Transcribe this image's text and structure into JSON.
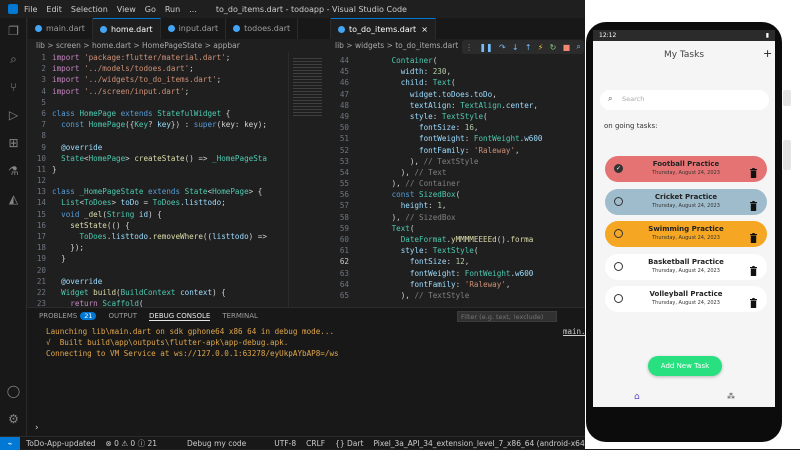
{
  "titlebar": {
    "menu": [
      "File",
      "Edit",
      "Selection",
      "View",
      "Go",
      "Run",
      "..."
    ],
    "title": "to_do_items.dart - todoapp - Visual Studio Code"
  },
  "left_editor": {
    "tabs": [
      "main.dart",
      "home.dart",
      "input.dart",
      "todoes.dart"
    ],
    "breadcrumb": "lib > screen > home.dart > HomePageState > appbar",
    "lines": [
      {
        "n": "1",
        "html": "<span class='p'>import</span> <span class='s'>'package:flutter/material.dart'</span>;"
      },
      {
        "n": "2",
        "html": "<span class='p'>import</span> <span class='s'>'../models/todoes.dart'</span>;"
      },
      {
        "n": "3",
        "html": "<span class='p'>import</span> <span class='s'>'../widgets/to_do_items.dart'</span>;"
      },
      {
        "n": "4",
        "html": "<span class='p'>import</span> <span class='s'>'../screen/input.dart'</span>;"
      },
      {
        "n": "5",
        "html": ""
      },
      {
        "n": "6",
        "html": "<span class='k'>class</span> <span class='t'>HomePage</span> <span class='k'>extends</span> <span class='t'>StatefulWidget</span> {"
      },
      {
        "n": "7",
        "html": "  <span class='k'>const</span> <span class='t'>HomePage</span>({<span class='t'>Key</span>? <span class='v'>key</span>}) : <span class='k'>super</span>(key: key);"
      },
      {
        "n": "8",
        "html": ""
      },
      {
        "n": "9",
        "html": "  <span class='v'>@override</span>"
      },
      {
        "n": "10",
        "html": "  <span class='t'>State</span>&lt;<span class='t'>HomePage</span>&gt; <span class='f'>createState</span>() =&gt; <span class='t'>_HomePageSta</span>"
      },
      {
        "n": "11",
        "html": "}"
      },
      {
        "n": "12",
        "html": ""
      },
      {
        "n": "13",
        "html": "<span class='k'>class</span> <span class='t'>_HomePageState</span> <span class='k'>extends</span> <span class='t'>State</span>&lt;<span class='t'>HomePage</span>&gt; {"
      },
      {
        "n": "14",
        "html": "  <span class='t'>List</span>&lt;<span class='t'>ToDoes</span>&gt; <span class='v'>toDo</span> = <span class='t'>ToDoes</span>.<span class='v'>listtodo</span>;"
      },
      {
        "n": "15",
        "html": "  <span class='k'>void</span> <span class='f'>_del</span>(<span class='t'>String</span> <span class='v'>id</span>) {"
      },
      {
        "n": "16",
        "html": "    <span class='f'>setState</span>(() {"
      },
      {
        "n": "17",
        "html": "      <span class='t'>ToDoes</span>.<span class='v'>listtodo</span>.<span class='f'>removeWhere</span>((<span class='v'>listtodo</span>) =&gt;"
      },
      {
        "n": "18",
        "html": "    });"
      },
      {
        "n": "19",
        "html": "  }"
      },
      {
        "n": "20",
        "html": ""
      },
      {
        "n": "21",
        "html": "  <span class='v'>@override</span>"
      },
      {
        "n": "22",
        "html": "  <span class='t'>Widget</span> <span class='f'>build</span>(<span class='t'>BuildContext</span> <span class='v'>context</span>) {"
      },
      {
        "n": "23",
        "html": "    <span class='p'>return</span> <span class='t'>Scaffold</span>("
      }
    ]
  },
  "right_editor": {
    "tab": "to_do_items.dart",
    "breadcrumb": "lib > widgets > to_do_items.dart",
    "lines": [
      {
        "n": "44",
        "html": "        <span class='t'>Container</span>("
      },
      {
        "n": "45",
        "html": "          <span class='v'>width</span>: <span class='n'>230</span>,"
      },
      {
        "n": "46",
        "html": "          <span class='v'>child</span>: <span class='t'>Text</span>("
      },
      {
        "n": "47",
        "html": "            <span class='v'>widget</span>.<span class='v'>toDoes</span>.<span class='v'>toDo</span>,"
      },
      {
        "n": "48",
        "html": "            <span class='v'>textAlign</span>: <span class='t'>TextAlign</span>.<span class='v'>center</span>,"
      },
      {
        "n": "49",
        "html": "            <span class='v'>style</span>: <span class='t'>TextStyle</span>("
      },
      {
        "n": "50",
        "html": "              <span class='v'>fontSize</span>: <span class='n'>16</span>,"
      },
      {
        "n": "51",
        "html": "              <span class='v'>fontWeight</span>: <span class='t'>FontWeight</span>.<span class='v'>w600</span>"
      },
      {
        "n": "52",
        "html": "              <span class='v'>fontFamily</span>: <span class='s'>'Raleway'</span>,"
      },
      {
        "n": "53",
        "html": "            ), <span class='g'>// TextStyle</span>"
      },
      {
        "n": "54",
        "html": "          ), <span class='g'>// Text</span>"
      },
      {
        "n": "55",
        "html": "        ), <span class='g'>// Container</span>"
      },
      {
        "n": "56",
        "html": "        <span class='k'>const</span> <span class='t'>SizedBox</span>("
      },
      {
        "n": "57",
        "html": "          <span class='v'>height</span>: <span class='n'>1</span>,"
      },
      {
        "n": "58",
        "html": "        ), <span class='g'>// SizedBox</span>"
      },
      {
        "n": "59",
        "html": "        <span class='t'>Text</span>("
      },
      {
        "n": "60",
        "html": "          <span class='t'>DateFormat</span>.<span class='f'>yMMMMEEEEd</span>().<span class='f'>forma</span>"
      },
      {
        "n": "61",
        "html": "          <span class='v'>style</span>: <span class='t'>TextStyle</span>("
      },
      {
        "n": "62",
        "html": "            <span class='v'>fontSize</span>: <span class='n'>12</span>,"
      },
      {
        "n": "63",
        "html": "            <span class='v'>fontWeight</span>: <span class='t'>FontWeight</span>.<span class='v'>w600</span>"
      },
      {
        "n": "64",
        "html": "            <span class='v'>fontFamily</span>: <span class='s'>'Raleway'</span>,"
      },
      {
        "n": "65",
        "html": "          ), <span class='g'>// TextStyle</span>"
      }
    ]
  },
  "panel": {
    "tabs": [
      "PROBLEMS",
      "OUTPUT",
      "DEBUG CONSOLE",
      "TERMINAL"
    ],
    "problems_count": "21",
    "filter_placeholder": "Filter (e.g. text, !exclude)",
    "main_link": "main.",
    "lines": [
      "Launching lib\\main.dart on sdk gphone64 x86 64 in debug mode...",
      "√  Built build\\app\\outputs\\flutter-apk\\app-debug.apk.",
      "Connecting to VM Service at ws://127.0.0.1:63278/eyUkpAYbAP8=/ws"
    ]
  },
  "statusbar": {
    "branch": "ToDo-App-updated",
    "problems": "⊗ 0 ⚠ 0 ⓘ 21",
    "debug": "Debug my code",
    "encoding": "UTF-8",
    "eol": "CRLF",
    "language": "{} Dart",
    "device": "Pixel_3a_API_34_extension_level_7_x86_64 (android-x64 emulator)"
  },
  "phone": {
    "time": "12:12",
    "title": "My Tasks",
    "search_placeholder": "Search",
    "section": "on going tasks:",
    "add_button": "Add New Task",
    "tasks": [
      {
        "title": "Football Practice",
        "date": "Thursday, August 24, 2023",
        "color": "#e57373",
        "done": true
      },
      {
        "title": "Cricket Practice",
        "date": "Thursday, August 24, 2023",
        "color": "#9fbccc",
        "done": false
      },
      {
        "title": "Swimming Practice",
        "date": "Thursday, August 24, 2023",
        "color": "#f5a623",
        "done": false
      },
      {
        "title": "Basketball Practice",
        "date": "Thursday, August 24, 2023",
        "color": "#ffffff",
        "done": false
      },
      {
        "title": "Volleyball Practice",
        "date": "Thursday, August 24, 2023",
        "color": "#ffffff",
        "done": false
      }
    ]
  }
}
